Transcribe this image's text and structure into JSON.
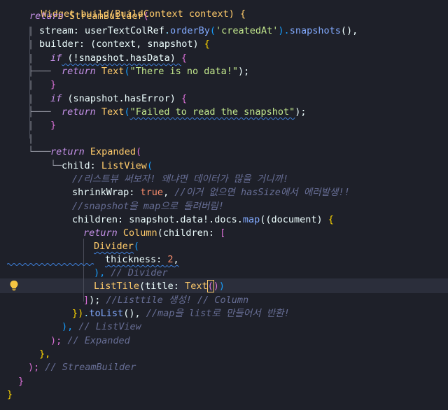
{
  "editor": {
    "lines": {
      "l0": "Widget build(BuildContext context) {",
      "l1_kw": "return",
      "l1_cls": "StreamBuilder",
      "l1_p": "(",
      "l2_a": "stream: ",
      "l2_b": "userTextColRef",
      "l2_c": ".",
      "l2_d": "orderBy",
      "l2_e": "(",
      "l2_f": "'createdAt'",
      "l2_g": ").",
      "l2_h": "snapshots",
      "l2_i": "(),",
      "l3_a": "builder: ",
      "l3_b": "(context, snapshot) ",
      "l3_c": "{",
      "l4_kw": "if",
      "l4_a": " (!snapshot.hasData) ",
      "l4_b": "{",
      "l5_kw": "return",
      "l5_cls": "Text",
      "l5_str": "\"There is no data!\"",
      "l5_end": ");",
      "l6": "}",
      "l7_kw": "if",
      "l7_a": " (snapshot.hasError) ",
      "l7_b": "{",
      "l8_kw": "return",
      "l8_cls": "Text",
      "l8_str": "\"Failed to read the snapshot\"",
      "l8_end": ");",
      "l9": "}",
      "l11_kw": "return",
      "l11_cls": "Expanded",
      "l11_p": "(",
      "l12_a": "child: ",
      "l12_cls": "ListView",
      "l12_p": "(",
      "l13_cmt": "//리스트뷰 써보자! 왜냐면 데이터가 많을 거니까!",
      "l14_a": "shrinkWrap: ",
      "l14_b": "true",
      "l14_c": ", ",
      "l14_cmt": "//이거 없으면 hasSize에서 에러발생!!",
      "l15_cmt": "//snapshot을 map으로 돌려버림!",
      "l16_a": "children: snapshot.data!.docs.",
      "l16_fn": "map",
      "l16_b": "((document) ",
      "l16_c": "{",
      "l17_kw": "return",
      "l17_cls": "Column",
      "l17_a": "(children: ",
      "l17_b": "[",
      "l18_cls": "Divider",
      "l18_p": "(",
      "l19_a": "thickness: ",
      "l19_num": "2",
      "l19_c": ",",
      "l20_a": "), ",
      "l20_cmt": "// Divider",
      "l21_cls": "ListTile",
      "l21_a": "(title: ",
      "l21_cls2": "Text",
      "l21_b": "(",
      "l21_c": ")",
      "l21_d": ")",
      "l22_a": "]",
      "l22_b": "); ",
      "l22_cmt": "//Listtile 생성! // Column",
      "l23_a": "})",
      "l23_b": ".",
      "l23_fn": "toList",
      "l23_c": "(), ",
      "l23_cmt": "//map을 list로 만들어서 반환!",
      "l24_a": "), ",
      "l24_cmt": "// ListView",
      "l25_a": "); ",
      "l25_cmt": "// Expanded",
      "l26": "},",
      "l27_a": "); ",
      "l27_cmt": "// StreamBuilder",
      "l28": "}",
      "l29": "}"
    },
    "colors": {
      "background": "#1e2029",
      "keyword": "#c792ea",
      "class": "#ffcb6b",
      "function": "#82aaff",
      "string": "#c3e88d",
      "comment": "#676e95"
    },
    "icons": {
      "lightbulb": "lightbulb-icon"
    }
  }
}
